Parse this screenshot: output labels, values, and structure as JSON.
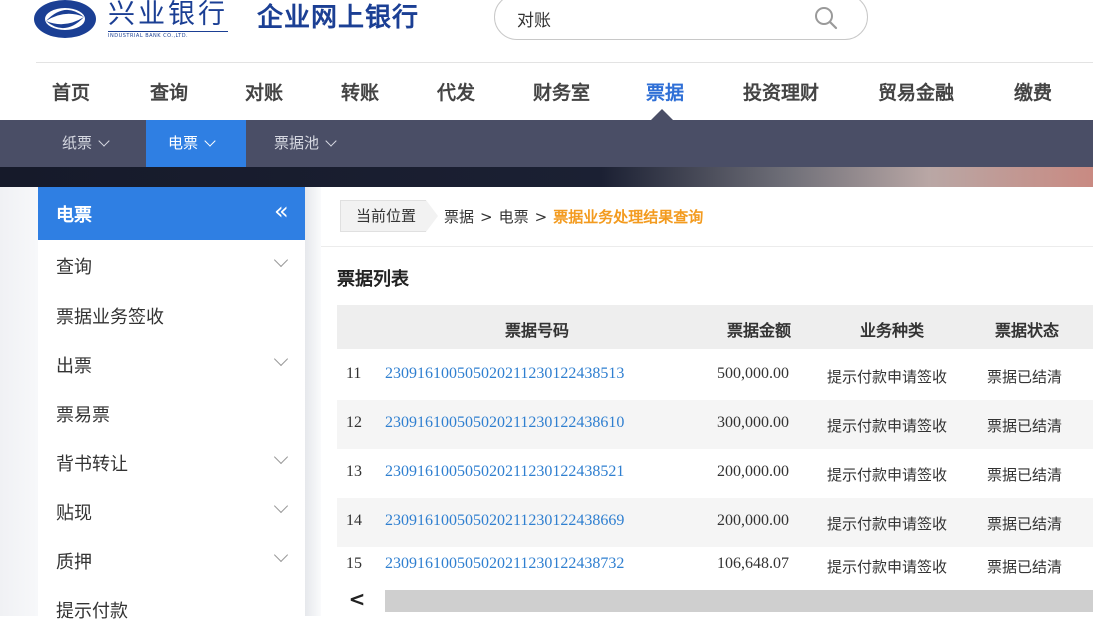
{
  "brand": {
    "bank_name": "兴业银行",
    "bank_name_en": "INDUSTRIAL BANK CO.,LTD.",
    "app_title": "企业网上银行",
    "brand_color": "#1b3f94"
  },
  "search": {
    "value": "对账",
    "icon": "search-icon"
  },
  "main_nav": [
    {
      "label": "首页",
      "active": false
    },
    {
      "label": "查询",
      "active": false
    },
    {
      "label": "对账",
      "active": false
    },
    {
      "label": "转账",
      "active": false
    },
    {
      "label": "代发",
      "active": false
    },
    {
      "label": "财务室",
      "active": false
    },
    {
      "label": "票据",
      "active": true
    },
    {
      "label": "投资理财",
      "active": false
    },
    {
      "label": "贸易金融",
      "active": false
    },
    {
      "label": "缴费",
      "active": false
    }
  ],
  "sub_nav": [
    {
      "label": "纸票",
      "active": false
    },
    {
      "label": "电票",
      "active": true
    },
    {
      "label": "票据池",
      "active": false
    }
  ],
  "sidebar": {
    "title": "电票",
    "collapse_icon": "«",
    "items": [
      {
        "label": "查询",
        "expandable": true
      },
      {
        "label": "票据业务签收",
        "expandable": false
      },
      {
        "label": "出票",
        "expandable": true
      },
      {
        "label": "票易票",
        "expandable": false
      },
      {
        "label": "背书转让",
        "expandable": true
      },
      {
        "label": "贴现",
        "expandable": true
      },
      {
        "label": "质押",
        "expandable": true
      },
      {
        "label": "提示付款",
        "expandable": false
      }
    ]
  },
  "breadcrumb": {
    "current_label": "当前位置",
    "path": [
      "票据",
      "电票"
    ],
    "separator": ">",
    "active": "票据业务处理结果查询"
  },
  "table": {
    "title": "票据列表",
    "columns": [
      "",
      "票据号码",
      "票据金额",
      "业务种类",
      "票据状态"
    ],
    "rows": [
      {
        "index": "11",
        "bill_no": "230916100505020211230122438513",
        "amount": "500,000.00",
        "business": "提示付款申请签收",
        "status": "票据已结清"
      },
      {
        "index": "12",
        "bill_no": "230916100505020211230122438610",
        "amount": "300,000.00",
        "business": "提示付款申请签收",
        "status": "票据已结清"
      },
      {
        "index": "13",
        "bill_no": "230916100505020211230122438521",
        "amount": "200,000.00",
        "business": "提示付款申请签收",
        "status": "票据已结清"
      },
      {
        "index": "14",
        "bill_no": "230916100505020211230122438669",
        "amount": "200,000.00",
        "business": "提示付款申请签收",
        "status": "票据已结清"
      },
      {
        "index": "15",
        "bill_no": "230916100505020211230122438732",
        "amount": "106,648.07",
        "business": "提示付款申请签收",
        "status": "票据已结清"
      }
    ]
  },
  "scrollbar": {
    "left_arrow": "<"
  },
  "colors": {
    "accent": "#2f7fe3",
    "subnav_bg": "#4a4e66",
    "link": "#2f7fd0",
    "breadcrumb_active": "#f39b1f"
  }
}
